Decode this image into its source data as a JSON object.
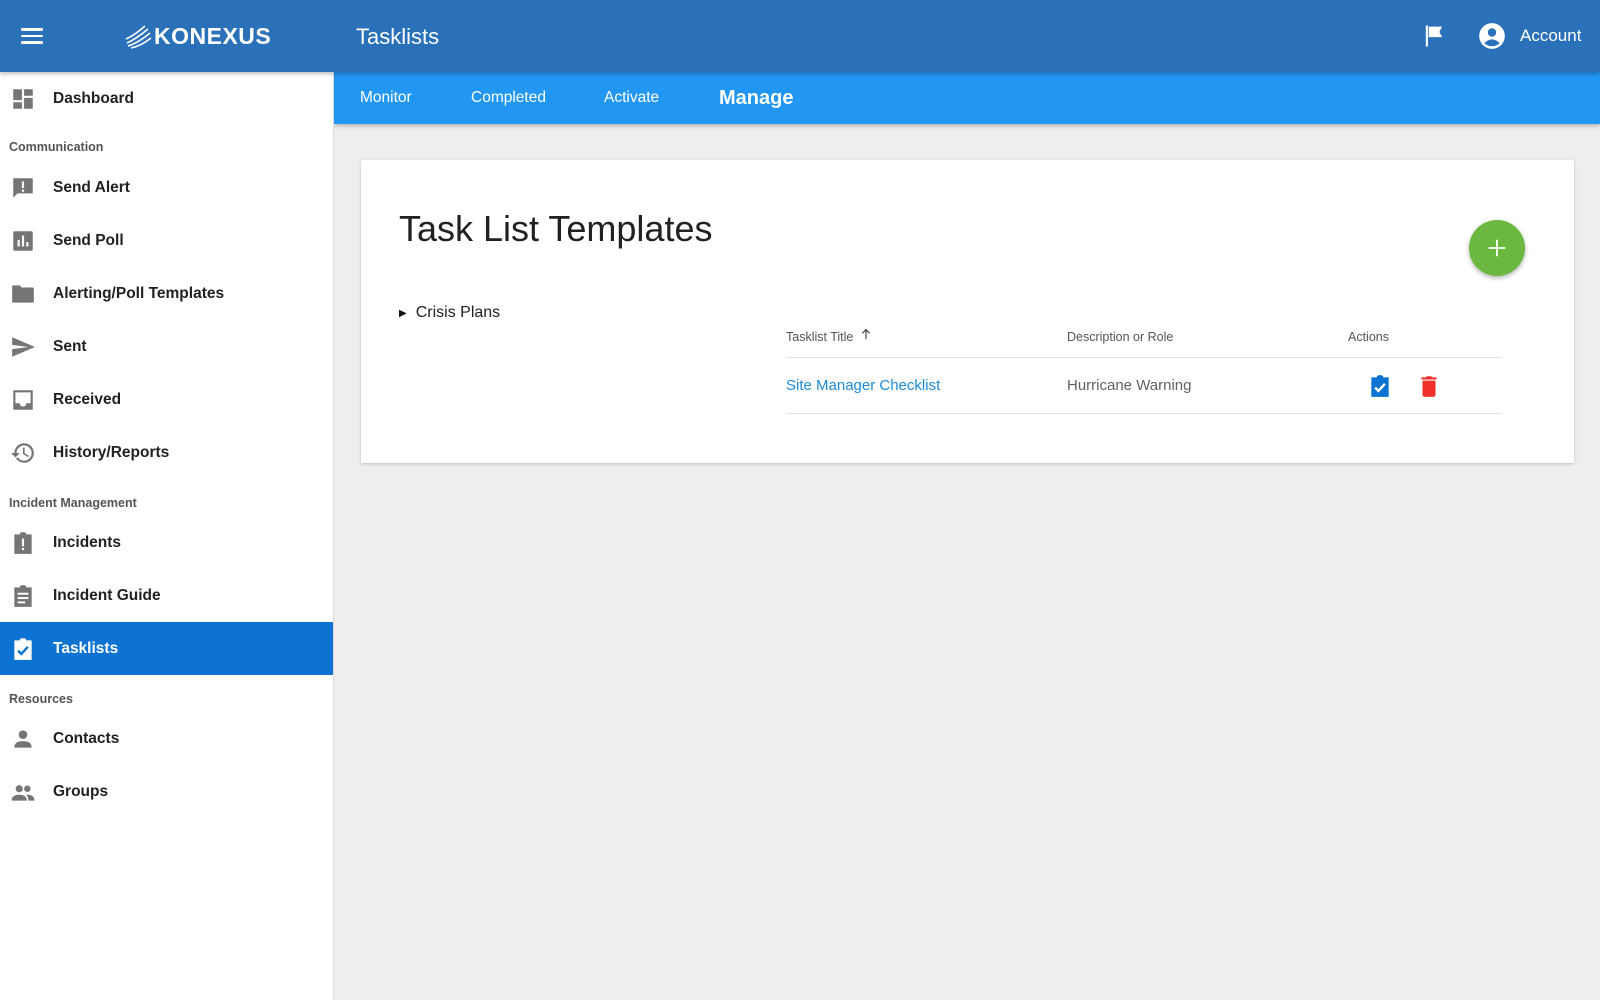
{
  "app": {
    "logo_text": "KONEXUS",
    "title": "Tasklists",
    "account_label": "Account",
    "colors": {
      "appbar": "#2a71b9",
      "tabbar": "#2196f3",
      "active_nav": "#0c73d2",
      "fab": "#6ab83f",
      "link": "#1b8bd6",
      "activate_action": "#0c73d2",
      "delete_action": "#f0312a"
    },
    "icons": [
      "menu-icon",
      "flag-icon",
      "account-circle-icon"
    ]
  },
  "sidebar": {
    "dashboard": {
      "label": "Dashboard",
      "icon": "dashboard-icon"
    },
    "communication": {
      "header": "Communication",
      "items": [
        {
          "label": "Send Alert",
          "icon": "alert-message-icon"
        },
        {
          "label": "Send Poll",
          "icon": "poll-icon"
        },
        {
          "label": "Alerting/Poll Templates",
          "icon": "folder-icon"
        },
        {
          "label": "Sent",
          "icon": "send-icon"
        },
        {
          "label": "Received",
          "icon": "inbox-icon"
        },
        {
          "label": "History/Reports",
          "icon": "history-icon"
        }
      ]
    },
    "incident_management": {
      "header": "Incident Management",
      "items": [
        {
          "label": "Incidents",
          "icon": "clipboard-alert-icon"
        },
        {
          "label": "Incident Guide",
          "icon": "clipboard-text-icon"
        },
        {
          "label": "Tasklists",
          "icon": "clipboard-check-icon",
          "active": true
        }
      ]
    },
    "resources": {
      "header": "Resources",
      "items": [
        {
          "label": "Contacts",
          "icon": "person-icon"
        },
        {
          "label": "Groups",
          "icon": "group-icon"
        }
      ]
    }
  },
  "tabs": [
    {
      "label": "Monitor"
    },
    {
      "label": "Completed"
    },
    {
      "label": "Activate"
    },
    {
      "label": "Manage",
      "active": true
    }
  ],
  "main": {
    "card_title": "Task List Templates",
    "fab_icon": "plus-icon",
    "category": {
      "label": "Crisis Plans",
      "expanded": false
    },
    "table": {
      "columns": [
        "Tasklist Title",
        "Description or Role",
        "Actions"
      ],
      "sort_column": "Tasklist Title",
      "sort_direction": "ascending",
      "rows": [
        {
          "title": "Site Manager Checklist",
          "description": "Hurricane Warning",
          "actions": [
            "activate-checklist-icon",
            "delete-icon"
          ]
        }
      ]
    }
  }
}
